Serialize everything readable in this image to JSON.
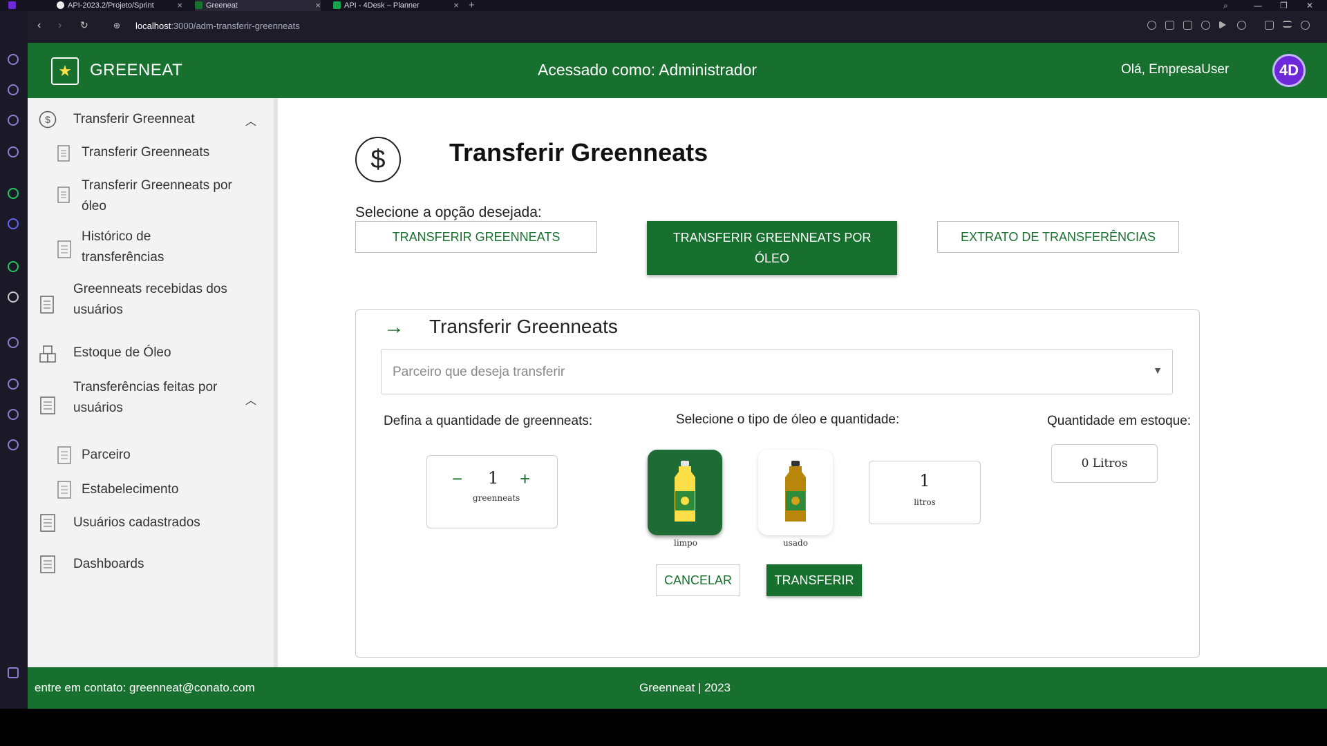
{
  "browser": {
    "tabs": [
      {
        "label": "API-2023.2/Projeto/Sprint",
        "active": false
      },
      {
        "label": "Greeneat",
        "active": true
      },
      {
        "label": "API - 4Desk – Planner",
        "active": false
      }
    ],
    "url_host": "localhost",
    "url_path": ":3000/adm-transferir-greenneats"
  },
  "header": {
    "brand": "GREENEAT",
    "access": "Acessado como: Administrador",
    "greeting": "Olá, EmpresaUser",
    "avatar_text": "4D"
  },
  "sidebar": {
    "items": [
      {
        "label": "Transferir Greenneat",
        "icon": "dollar-circle-icon",
        "expanded": true
      },
      {
        "label": "Transferir Greenneats",
        "icon": "document-icon"
      },
      {
        "label": "Transferir Greenneats por óleo",
        "icon": "document-icon"
      },
      {
        "label": "Histórico de transferências",
        "icon": "list-icon"
      },
      {
        "label": "Greenneats recebidas dos usuários",
        "icon": "document-icon"
      },
      {
        "label": "Estoque de Óleo",
        "icon": "boxes-icon"
      },
      {
        "label": "Transferências feitas por usuários",
        "icon": "list-icon",
        "expanded": true
      },
      {
        "label": "Parceiro",
        "icon": "list-icon"
      },
      {
        "label": "Estabelecimento",
        "icon": "list-icon"
      },
      {
        "label": "Usuários cadastrados",
        "icon": "list-icon"
      },
      {
        "label": "Dashboards",
        "icon": "list-icon"
      }
    ]
  },
  "main": {
    "title": "Transferir Greenneats",
    "select_label": "Selecione a opção desejada:",
    "options": [
      {
        "label": "TRANSFERIR GREENNEATS",
        "active": false
      },
      {
        "label": "TRANSFERIR GREENNEATS POR ÓLEO",
        "active": true
      },
      {
        "label": "EXTRATO DE TRANSFERÊNCIAS",
        "active": false
      }
    ],
    "card": {
      "title": "Transferir Greenneats",
      "partner_placeholder": "Parceiro que deseja transferir",
      "qty_label": "Defina a quantidade de greenneats:",
      "qty_value": "1",
      "qty_unit": "greenneats",
      "oil_label": "Selecione o tipo de óleo e quantidade:",
      "oil_types": [
        {
          "label": "limpo",
          "selected": true
        },
        {
          "label": "usado",
          "selected": false
        }
      ],
      "liters_value": "1",
      "liters_unit": "litros",
      "stock_label": "Quantidade em estoque:",
      "stock_value": "0 Litros",
      "cancel_label": "CANCELAR",
      "transfer_label": "TRANSFERIR"
    }
  },
  "footer": {
    "contact": "entre em contato: greenneat@conato.com",
    "copyright": "Greenneat | 2023"
  },
  "colors": {
    "brand_green": "#18702f",
    "avatar_purple": "#6d28d9"
  }
}
